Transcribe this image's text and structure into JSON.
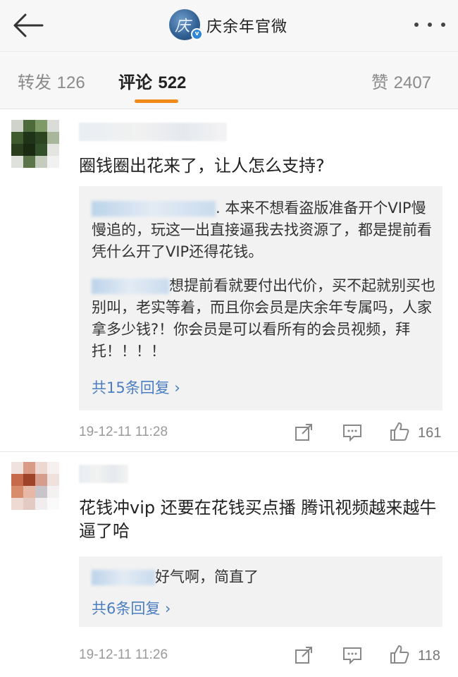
{
  "header": {
    "account_name": "庆余年官微",
    "avatar_glyph": "庆",
    "verify_mark": "v",
    "icons": {
      "back": "back-arrow-icon",
      "more": "more-dots-icon"
    }
  },
  "tabs": [
    {
      "label": "转发",
      "count": "126"
    },
    {
      "label": "评论",
      "count": "522"
    },
    {
      "label": "赞",
      "count": "2407"
    }
  ],
  "comments": [
    {
      "text": "圈钱圈出花来了，让人怎么支持?",
      "replies": [
        {
          "text": ". 本来不想看盗版准备开个VIP慢慢追的，玩这一出直接逼我去找资源了，都是提前看凭什么开了VIP还得花钱。"
        },
        {
          "text": "想提前看就要付出代价，买不起就别买也别叫，老实等着，而且你会员是庆余年专属吗，人家拿多少钱?！你会员是可以看所有的会员视频，拜托！！！！"
        }
      ],
      "more_replies": "共15条回复 ›",
      "time": "19-12-11 11:28",
      "likes": "161"
    },
    {
      "text": "花钱冲vip  还要在花钱买点播  腾讯视频越来越牛逼了哈",
      "replies": [
        {
          "text": "好气啊，简直了"
        }
      ],
      "more_replies": "共6条回复 ›",
      "time": "19-12-11 11:26",
      "likes": "118"
    }
  ],
  "colors": {
    "accent": "#f08a18",
    "link": "#4a7ec0",
    "verify": "#2f86d6"
  }
}
